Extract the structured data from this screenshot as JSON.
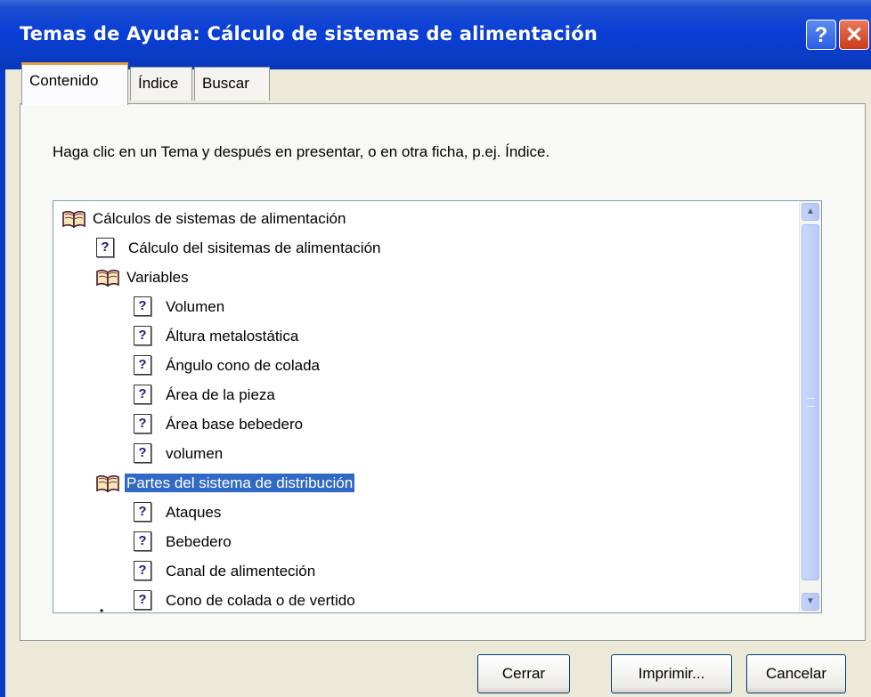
{
  "window": {
    "title": "Temas de Ayuda: Cálculo de sistemas de alimentación",
    "help_glyph": "?",
    "close_glyph": "✕"
  },
  "tabs": [
    {
      "label": "Contenido",
      "active": true
    },
    {
      "label": "Índice",
      "active": false
    },
    {
      "label": "Buscar",
      "active": false
    }
  ],
  "instruction": "Haga clic en un Tema y después en presentar, o en otra ficha, p.ej. Índice.",
  "tree": {
    "items": [
      {
        "label": "Cálculos de sistemas de alimentación",
        "icon": "book-icon",
        "level": 0
      },
      {
        "label": "Cálculo del sisitemas de alimentación",
        "icon": "help-topic-icon",
        "level": 1
      },
      {
        "label": "Variables",
        "icon": "book-icon",
        "level": 1
      },
      {
        "label": "Volumen",
        "icon": "help-topic-icon",
        "level": 2
      },
      {
        "label": "Áltura metalostática",
        "icon": "help-topic-icon",
        "level": 2
      },
      {
        "label": "Ángulo cono de colada",
        "icon": "help-topic-icon",
        "level": 2
      },
      {
        "label": "Área de la pieza",
        "icon": "help-topic-icon",
        "level": 2
      },
      {
        "label": "Área base bebedero",
        "icon": "help-topic-icon",
        "level": 2
      },
      {
        "label": "volumen",
        "icon": "help-topic-icon",
        "level": 2
      },
      {
        "label": "Partes del sistema de distribución",
        "icon": "book-icon",
        "level": 1,
        "selected": true
      },
      {
        "label": "Ataques",
        "icon": "help-topic-icon",
        "level": 2
      },
      {
        "label": "Bebedero",
        "icon": "help-topic-icon",
        "level": 2
      },
      {
        "label": "Canal de alimenteción",
        "icon": "help-topic-icon",
        "level": 2
      },
      {
        "label": "Cono de colada o de vertido",
        "icon": "help-topic-icon",
        "level": 2
      }
    ],
    "help_glyph": "?"
  },
  "scrollbar": {
    "up_glyph": "▲",
    "down_glyph": "▼"
  },
  "buttons": {
    "close": "Cerrar",
    "print": "Imprimir...",
    "cancel": "Cancelar"
  },
  "colors": {
    "titlebar": "#0a3fd6",
    "selection": "#316ac5",
    "dialog_bg": "#ece9d8"
  }
}
